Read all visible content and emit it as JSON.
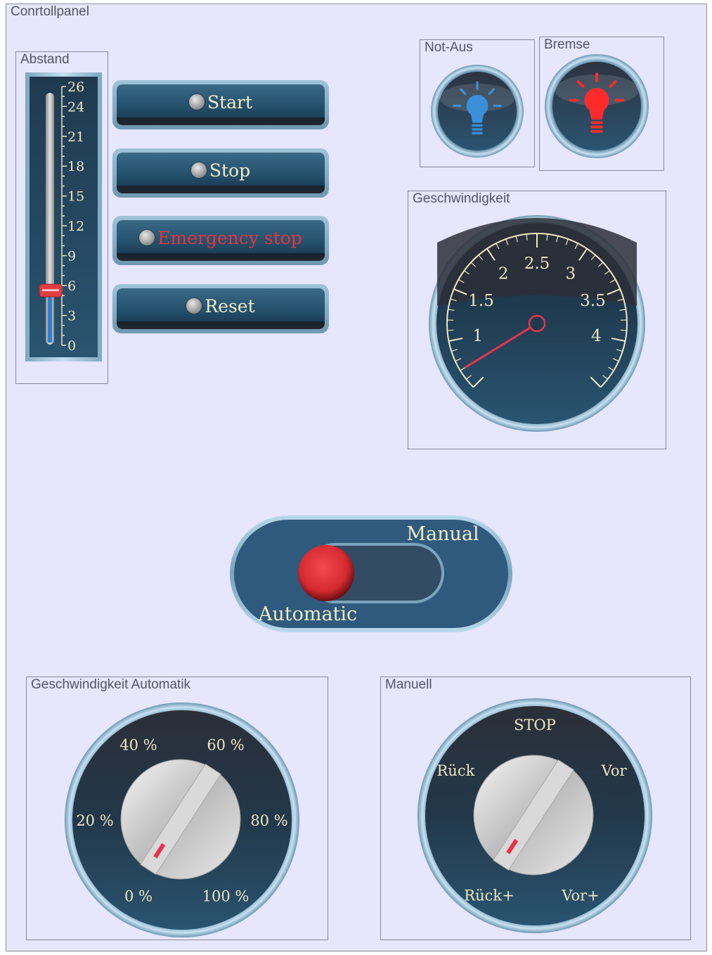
{
  "panel": {
    "title": "Conrtollpanel"
  },
  "distance": {
    "title": "Abstand",
    "ticks": [
      "26",
      "24",
      "21",
      "18",
      "15",
      "12",
      "9",
      "6",
      "3",
      "0"
    ],
    "value": 5.5,
    "min": 0,
    "max": 26
  },
  "buttons": [
    {
      "label": "Start",
      "color": "#f0ecc8"
    },
    {
      "label": "Stop",
      "color": "#f0ecc8"
    },
    {
      "label": "Emergency stop",
      "color": "#e8333c"
    },
    {
      "label": "Reset",
      "color": "#f0ecc8"
    }
  ],
  "lamps": [
    {
      "title": "Not-Aus",
      "color": "#3a8fd9",
      "icon": "lightbulb-icon"
    },
    {
      "title": "Bremse",
      "color": "#ff2b2b",
      "icon": "lightbulb-icon"
    }
  ],
  "speed": {
    "title": "Geschwindigkeit",
    "labels": [
      "1",
      "1.5",
      "2",
      "2.5",
      "3",
      "3.5",
      "4"
    ],
    "value": 0.7
  },
  "mode_switch": {
    "on_label": "Manual",
    "off_label": "Automatic",
    "state": "Automatic",
    "knob_color": "#d42a30"
  },
  "auto_speed": {
    "title": "Geschwindigkeit Automatik",
    "labels": [
      "0 %",
      "20 %",
      "40 %",
      "60 %",
      "80 %",
      "100 %"
    ],
    "selected": "0 %"
  },
  "manual": {
    "title": "Manuell",
    "labels": [
      "Rück+",
      "Rück",
      "STOP",
      "Vor",
      "Vor+"
    ],
    "selected": "Rück+"
  }
}
